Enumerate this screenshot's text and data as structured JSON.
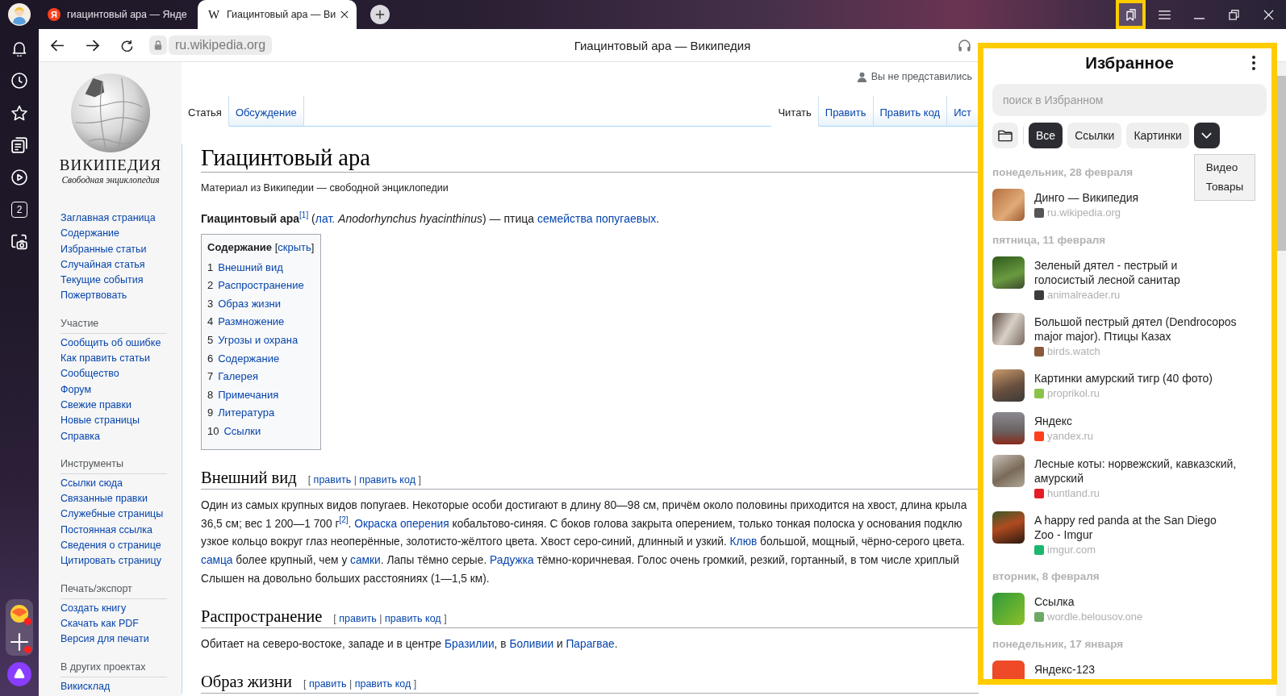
{
  "browser": {
    "tabs": [
      {
        "favicon": {
          "kind": "circle",
          "text": "Я"
        },
        "title": "гиацинтовый ара — Янде",
        "selected": false
      },
      {
        "favicon": {
          "kind": "letter",
          "text": "W"
        },
        "title": "Гиацинтовый ара — Ви",
        "selected": true
      }
    ],
    "bookmarks_button_highlighted": true,
    "url": "ru.wikipedia.org",
    "page_title": "Гиацинтовый ара — Википедия"
  },
  "sidebar": {
    "counter": "2",
    "mail_badge": true,
    "add_badge": true
  },
  "wiki": {
    "logo": {
      "wordmark": "ВИКИПЕДИЯ",
      "tagline": "Свободная энциклопедия"
    },
    "nav_main": [
      "Заглавная страница",
      "Содержание",
      "Избранные статьи",
      "Случайная статья",
      "Текущие события",
      "Пожертвовать"
    ],
    "nav_sections": [
      {
        "heading": "Участие",
        "links": [
          "Сообщить об ошибке",
          "Как править статьи",
          "Сообщество",
          "Форум",
          "Свежие правки",
          "Новые страницы",
          "Справка"
        ]
      },
      {
        "heading": "Инструменты",
        "links": [
          "Ссылки сюда",
          "Связанные правки",
          "Служебные страницы",
          "Постоянная ссылка",
          "Сведения о странице",
          "Цитировать страницу"
        ]
      },
      {
        "heading": "Печать/экспорт",
        "links": [
          "Создать книгу",
          "Скачать как PDF",
          "Версия для печати"
        ]
      },
      {
        "heading": "В других проектах",
        "links": [
          "Викисклад"
        ]
      }
    ],
    "user": "Вы не представились",
    "tabs_left": [
      {
        "label": "Статья",
        "selected": true
      },
      {
        "label": "Обсуждение",
        "selected": false
      }
    ],
    "tabs_right": [
      {
        "label": "Читать",
        "selected": true
      },
      {
        "label": "Править",
        "selected": false
      },
      {
        "label": "Править код",
        "selected": false
      },
      {
        "label": "Ист",
        "selected": false
      }
    ],
    "title": "Гиацинтовый ара",
    "subtitle": "Материал из Википедии — свободной энциклопедии",
    "lead": [
      {
        "kind": "bold",
        "text": "Гиацинтовый ара"
      },
      {
        "kind": "sup",
        "text": "[1]"
      },
      {
        "kind": "plain",
        "text": " ("
      },
      {
        "kind": "link",
        "text": "лат."
      },
      {
        "kind": "italic",
        "text": " Anodorhynchus hyacinthinus"
      },
      {
        "kind": "plain",
        "text": ") — птица "
      },
      {
        "kind": "link",
        "text": "семейства попугаевых"
      },
      {
        "kind": "plain",
        "text": "."
      }
    ],
    "toc": {
      "title": "Содержание",
      "toggle": [
        {
          "kind": "plain",
          "text": " ["
        },
        {
          "kind": "link",
          "text": "скрыть"
        },
        {
          "kind": "plain",
          "text": "]"
        }
      ],
      "items": [
        {
          "number": "1",
          "label": "Внешний вид"
        },
        {
          "number": "2",
          "label": "Распространение"
        },
        {
          "number": "3",
          "label": "Образ жизни"
        },
        {
          "number": "4",
          "label": "Размножение"
        },
        {
          "number": "5",
          "label": "Угрозы и охрана"
        },
        {
          "number": "6",
          "label": "Содержание"
        },
        {
          "number": "7",
          "label": "Галерея"
        },
        {
          "number": "8",
          "label": "Примечания"
        },
        {
          "number": "9",
          "label": "Литература"
        },
        {
          "number": "10",
          "label": "Ссылки"
        }
      ]
    },
    "sections": [
      {
        "heading": "Внешний вид",
        "edit": [
          {
            "kind": "plain",
            "text": "[ "
          },
          {
            "kind": "link",
            "text": "править"
          },
          {
            "kind": "plain",
            "text": " | "
          },
          {
            "kind": "link",
            "text": "править код"
          },
          {
            "kind": "plain",
            "text": " ]"
          }
        ],
        "lines": [
          [
            {
              "kind": "plain",
              "text": "Один из самых крупных видов попугаев. Некоторые особи достигают в длину 80—98 см, причём около половины приходится на хвост, длина крыла"
            }
          ],
          [
            {
              "kind": "plain",
              "text": "36,5 см; вес 1 200—1 700 г"
            },
            {
              "kind": "sup",
              "text": "[2]"
            },
            {
              "kind": "plain",
              "text": ". "
            },
            {
              "kind": "link",
              "text": "Окраска оперения"
            },
            {
              "kind": "plain",
              "text": " кобальтово-синяя. С боков голова закрыта оперением, только тонкая полоска у основания подклю"
            }
          ],
          [
            {
              "kind": "plain",
              "text": "узкое кольцо вокруг глаз неоперённые, золотисто-жёлтого цвета. Хвост серо-синий, длинный и узкий. "
            },
            {
              "kind": "link",
              "text": "Клюв"
            },
            {
              "kind": "plain",
              "text": " большой, мощный, чёрно-серого цвета."
            }
          ],
          [
            {
              "kind": "link",
              "text": "самца"
            },
            {
              "kind": "plain",
              "text": " более крупный, чем у "
            },
            {
              "kind": "link",
              "text": "самки"
            },
            {
              "kind": "plain",
              "text": ". Лапы тёмно серые. "
            },
            {
              "kind": "link",
              "text": "Радужка"
            },
            {
              "kind": "plain",
              "text": " тёмно-коричневая. Голос очень громкий, резкий, гортанный, в том числе хриплый"
            }
          ],
          [
            {
              "kind": "plain",
              "text": "Слышен на довольно больших расстояниях (1—1,5 км)."
            }
          ]
        ]
      },
      {
        "heading": "Распространение",
        "edit": [
          {
            "kind": "plain",
            "text": "[ "
          },
          {
            "kind": "link",
            "text": "править"
          },
          {
            "kind": "plain",
            "text": " | "
          },
          {
            "kind": "link",
            "text": "править код"
          },
          {
            "kind": "plain",
            "text": " ]"
          }
        ],
        "lines": [
          [
            {
              "kind": "plain",
              "text": "Обитает на северо-востоке, западе и в центре "
            },
            {
              "kind": "link",
              "text": "Бразилии"
            },
            {
              "kind": "plain",
              "text": ", в "
            },
            {
              "kind": "link",
              "text": "Боливии"
            },
            {
              "kind": "plain",
              "text": " и "
            },
            {
              "kind": "link",
              "text": "Парагвае"
            },
            {
              "kind": "plain",
              "text": "."
            }
          ]
        ]
      },
      {
        "heading": "Образ жизни",
        "edit": [
          {
            "kind": "plain",
            "text": "[ "
          },
          {
            "kind": "link",
            "text": "править"
          },
          {
            "kind": "plain",
            "text": " | "
          },
          {
            "kind": "link",
            "text": "править код"
          },
          {
            "kind": "plain",
            "text": " ]"
          }
        ]
      }
    ]
  },
  "favorites": {
    "highlighted": true,
    "title": "Избранное",
    "search_placeholder": "поиск в Избранном",
    "filters": [
      {
        "label": "Все",
        "selected": true
      },
      {
        "label": "Ссылки",
        "selected": false
      },
      {
        "label": "Картинки",
        "selected": false
      }
    ],
    "more_filters_expanded": true,
    "more_filters": [
      "Видео",
      "Товары"
    ],
    "groups": [
      {
        "date": "понедельник, 28 февраля",
        "items": [
          {
            "title": "Динго — Википедия",
            "site": "ru.wikipedia.org",
            "color": "#555555"
          }
        ]
      },
      {
        "date": "пятница, 11 февраля",
        "items": [
          {
            "title": "Зеленый дятел - пестрый и голосистый лесной санитар",
            "site": "animalreader.ru",
            "color": "#3c3c3c"
          },
          {
            "title": "Большой пестрый дятел (Dendrocopos major major). Птицы Казах",
            "site": "birds.watch",
            "color": "#8a5a3a"
          },
          {
            "title": "Картинки амурский тигр (40 фото)",
            "site": "proprikol.ru",
            "color": "#8bc34a"
          },
          {
            "title": "Яндекс",
            "site": "yandex.ru",
            "color": "#fc3f1d"
          },
          {
            "title": "Лесные коты: норвежский, кавказский, амурский",
            "site": "huntland.ru",
            "color": "#e31e24"
          },
          {
            "title": "A happy red panda at the San Diego Zoo - Imgur",
            "site": "imgur.com",
            "color": "#1bb76e"
          }
        ]
      },
      {
        "date": "вторник, 8 февраля",
        "items": [
          {
            "title": "Ссылка",
            "site": "wordle.belousov.one",
            "color": "#6aaa64"
          }
        ]
      },
      {
        "date": "понедельник, 17 января",
        "items": [
          {
            "title": "Яндекс-123"
          }
        ]
      }
    ]
  }
}
